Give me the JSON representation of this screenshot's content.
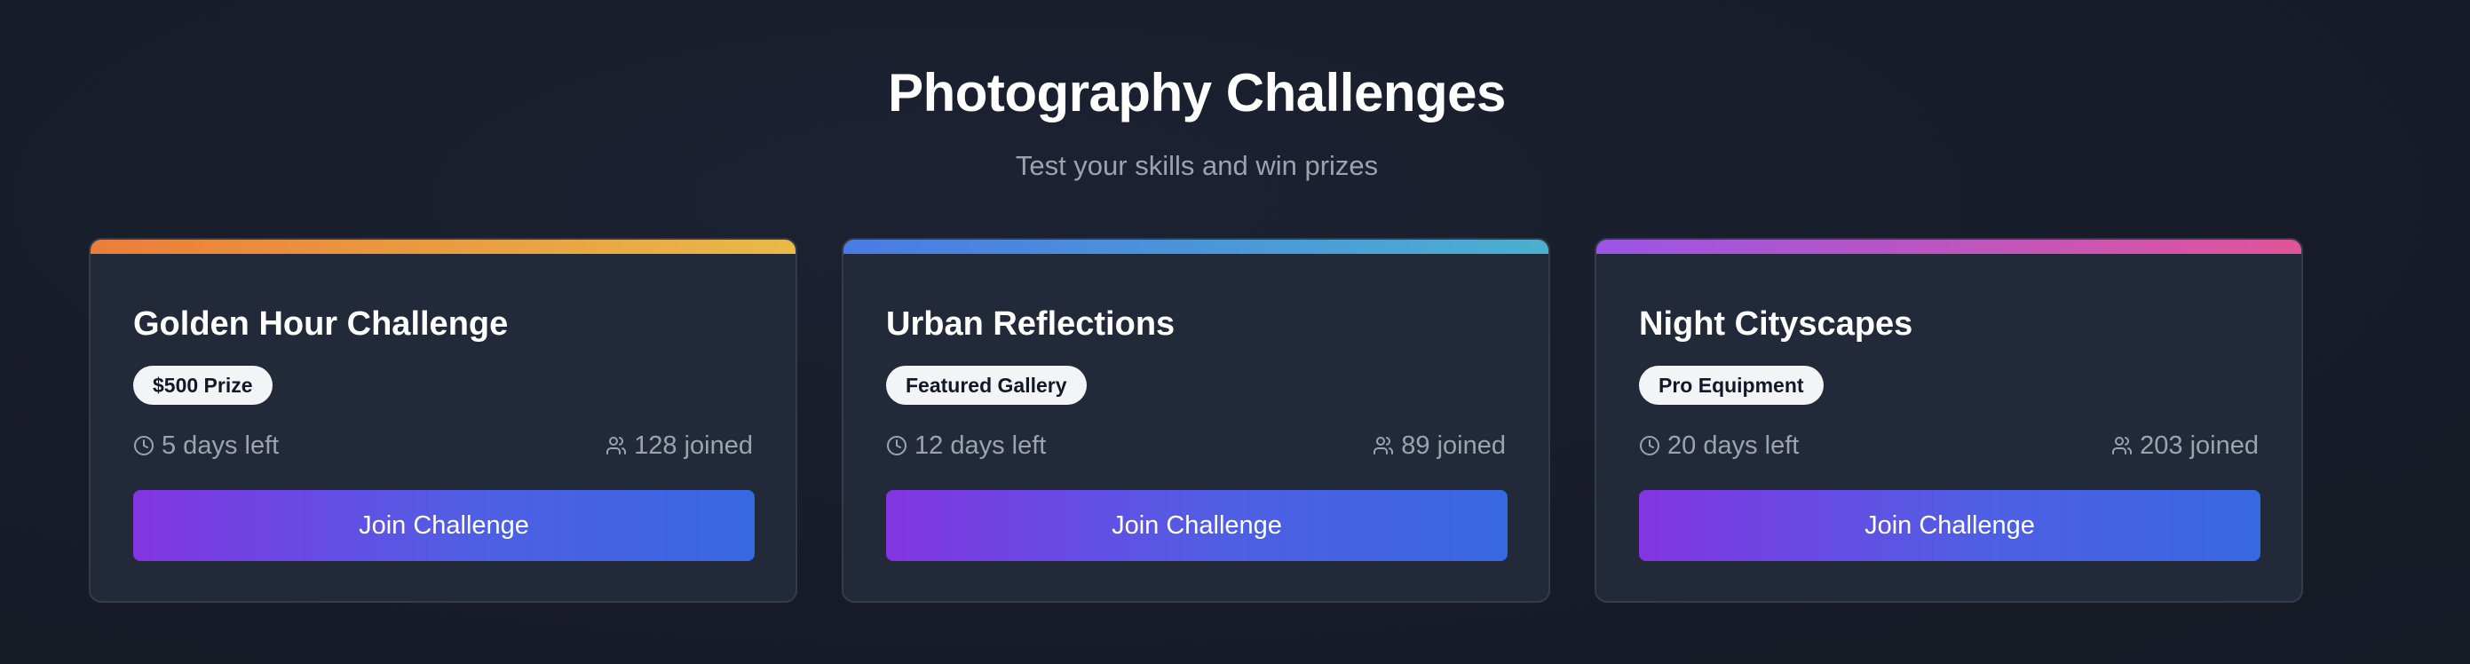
{
  "header": {
    "title": "Photography Challenges",
    "subtitle": "Test your skills and win prizes"
  },
  "cards": [
    {
      "title": "Golden Hour Challenge",
      "badge": "$500 Prize",
      "time_left": "5 days left",
      "joined": "128 joined",
      "button_label": "Join Challenge",
      "accent_colors": [
        "#ea7e3a",
        "#e9b949"
      ]
    },
    {
      "title": "Urban Reflections",
      "badge": "Featured Gallery",
      "time_left": "12 days left",
      "joined": "89 joined",
      "button_label": "Join Challenge",
      "accent_colors": [
        "#4a7be4",
        "#4bb0d0"
      ]
    },
    {
      "title": "Night Cityscapes",
      "badge": "Pro Equipment",
      "time_left": "20 days left",
      "joined": "203 joined",
      "button_label": "Join Challenge",
      "accent_colors": [
        "#9b55e6",
        "#e0559a"
      ]
    }
  ],
  "icons": {
    "time": "clock-icon",
    "participants": "users-icon"
  }
}
